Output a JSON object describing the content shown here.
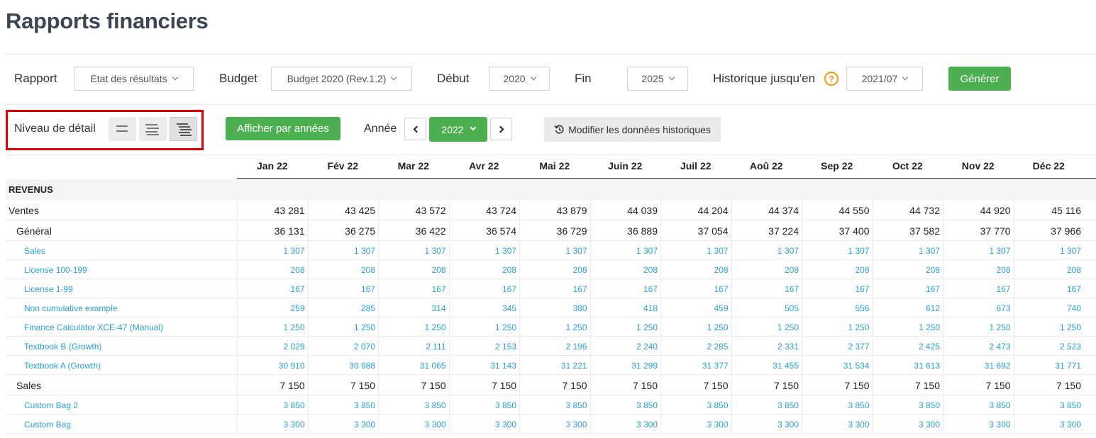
{
  "page": {
    "title": "Rapports financiers"
  },
  "filters": {
    "report_label": "Rapport",
    "report_value": "État des résultats",
    "budget_label": "Budget",
    "budget_value": "Budget 2020 (Rev.1.2)",
    "start_label": "Début",
    "start_value": "2020",
    "end_label": "Fin",
    "end_value": "2025",
    "history_label": "Historique jusqu'en",
    "history_value": "2021/07",
    "generate_label": "Générer"
  },
  "toolbar": {
    "detail_label": "Niveau de détail",
    "detail_levels": [
      "detail-level-1-icon",
      "detail-level-2-icon",
      "detail-level-3-icon"
    ],
    "active_detail_level": 3,
    "show_by_years_label": "Afficher par années",
    "year_label": "Année",
    "year_value": "2022",
    "edit_history_label": "Modifier les données historiques"
  },
  "colors": {
    "accent_green": "#4caf50",
    "link_blue": "#2aa0d8",
    "highlight_red": "#e00000",
    "help_orange": "#f39c12"
  },
  "table": {
    "months": [
      "Jan 22",
      "Fév 22",
      "Mar 22",
      "Avr 22",
      "Mai 22",
      "Juin 22",
      "Juil 22",
      "Aoû 22",
      "Sep 22",
      "Oct 22",
      "Nov 22",
      "Déc 22"
    ],
    "section": "REVENUS",
    "rows": [
      {
        "name": "Ventes",
        "level": 0,
        "values": [
          "43 281",
          "43 425",
          "43 572",
          "43 724",
          "43 879",
          "44 039",
          "44 204",
          "44 374",
          "44 550",
          "44 732",
          "44 920",
          "45 116"
        ]
      },
      {
        "name": "Général",
        "level": 1,
        "values": [
          "36 131",
          "36 275",
          "36 422",
          "36 574",
          "36 729",
          "36 889",
          "37 054",
          "37 224",
          "37 400",
          "37 582",
          "37 770",
          "37 966"
        ]
      },
      {
        "name": "Sales",
        "level": 2,
        "values": [
          "1 307",
          "1 307",
          "1 307",
          "1 307",
          "1 307",
          "1 307",
          "1 307",
          "1 307",
          "1 307",
          "1 307",
          "1 307",
          "1 307"
        ]
      },
      {
        "name": "License 100-199",
        "level": 2,
        "values": [
          "208",
          "208",
          "208",
          "208",
          "208",
          "208",
          "208",
          "208",
          "208",
          "208",
          "208",
          "208"
        ]
      },
      {
        "name": "License 1-99",
        "level": 2,
        "values": [
          "167",
          "167",
          "167",
          "167",
          "167",
          "167",
          "167",
          "167",
          "167",
          "167",
          "167",
          "167"
        ]
      },
      {
        "name": "Non cumulative example",
        "level": 2,
        "values": [
          "259",
          "285",
          "314",
          "345",
          "380",
          "418",
          "459",
          "505",
          "556",
          "612",
          "673",
          "740"
        ]
      },
      {
        "name": "Finance Calculator XCE-47 (Manual)",
        "level": 2,
        "values": [
          "1 250",
          "1 250",
          "1 250",
          "1 250",
          "1 250",
          "1 250",
          "1 250",
          "1 250",
          "1 250",
          "1 250",
          "1 250",
          "1 250"
        ]
      },
      {
        "name": "Textbook B (Growth)",
        "level": 2,
        "values": [
          "2 029",
          "2 070",
          "2 111",
          "2 153",
          "2 196",
          "2 240",
          "2 285",
          "2 331",
          "2 377",
          "2 425",
          "2 473",
          "2 523"
        ]
      },
      {
        "name": "Textbook A (Growth)",
        "level": 2,
        "values": [
          "30 910",
          "30 988",
          "31 065",
          "31 143",
          "31 221",
          "31 299",
          "31 377",
          "31 455",
          "31 534",
          "31 613",
          "31 692",
          "31 771"
        ]
      },
      {
        "name": "Sales",
        "level": 1,
        "values": [
          "7 150",
          "7 150",
          "7 150",
          "7 150",
          "7 150",
          "7 150",
          "7 150",
          "7 150",
          "7 150",
          "7 150",
          "7 150",
          "7 150"
        ]
      },
      {
        "name": "Custom Bag 2",
        "level": 2,
        "values": [
          "3 850",
          "3 850",
          "3 850",
          "3 850",
          "3 850",
          "3 850",
          "3 850",
          "3 850",
          "3 850",
          "3 850",
          "3 850",
          "3 850"
        ]
      },
      {
        "name": "Custom Bag",
        "level": 2,
        "values": [
          "3 300",
          "3 300",
          "3 300",
          "3 300",
          "3 300",
          "3 300",
          "3 300",
          "3 300",
          "3 300",
          "3 300",
          "3 300",
          "3 300"
        ]
      }
    ]
  }
}
